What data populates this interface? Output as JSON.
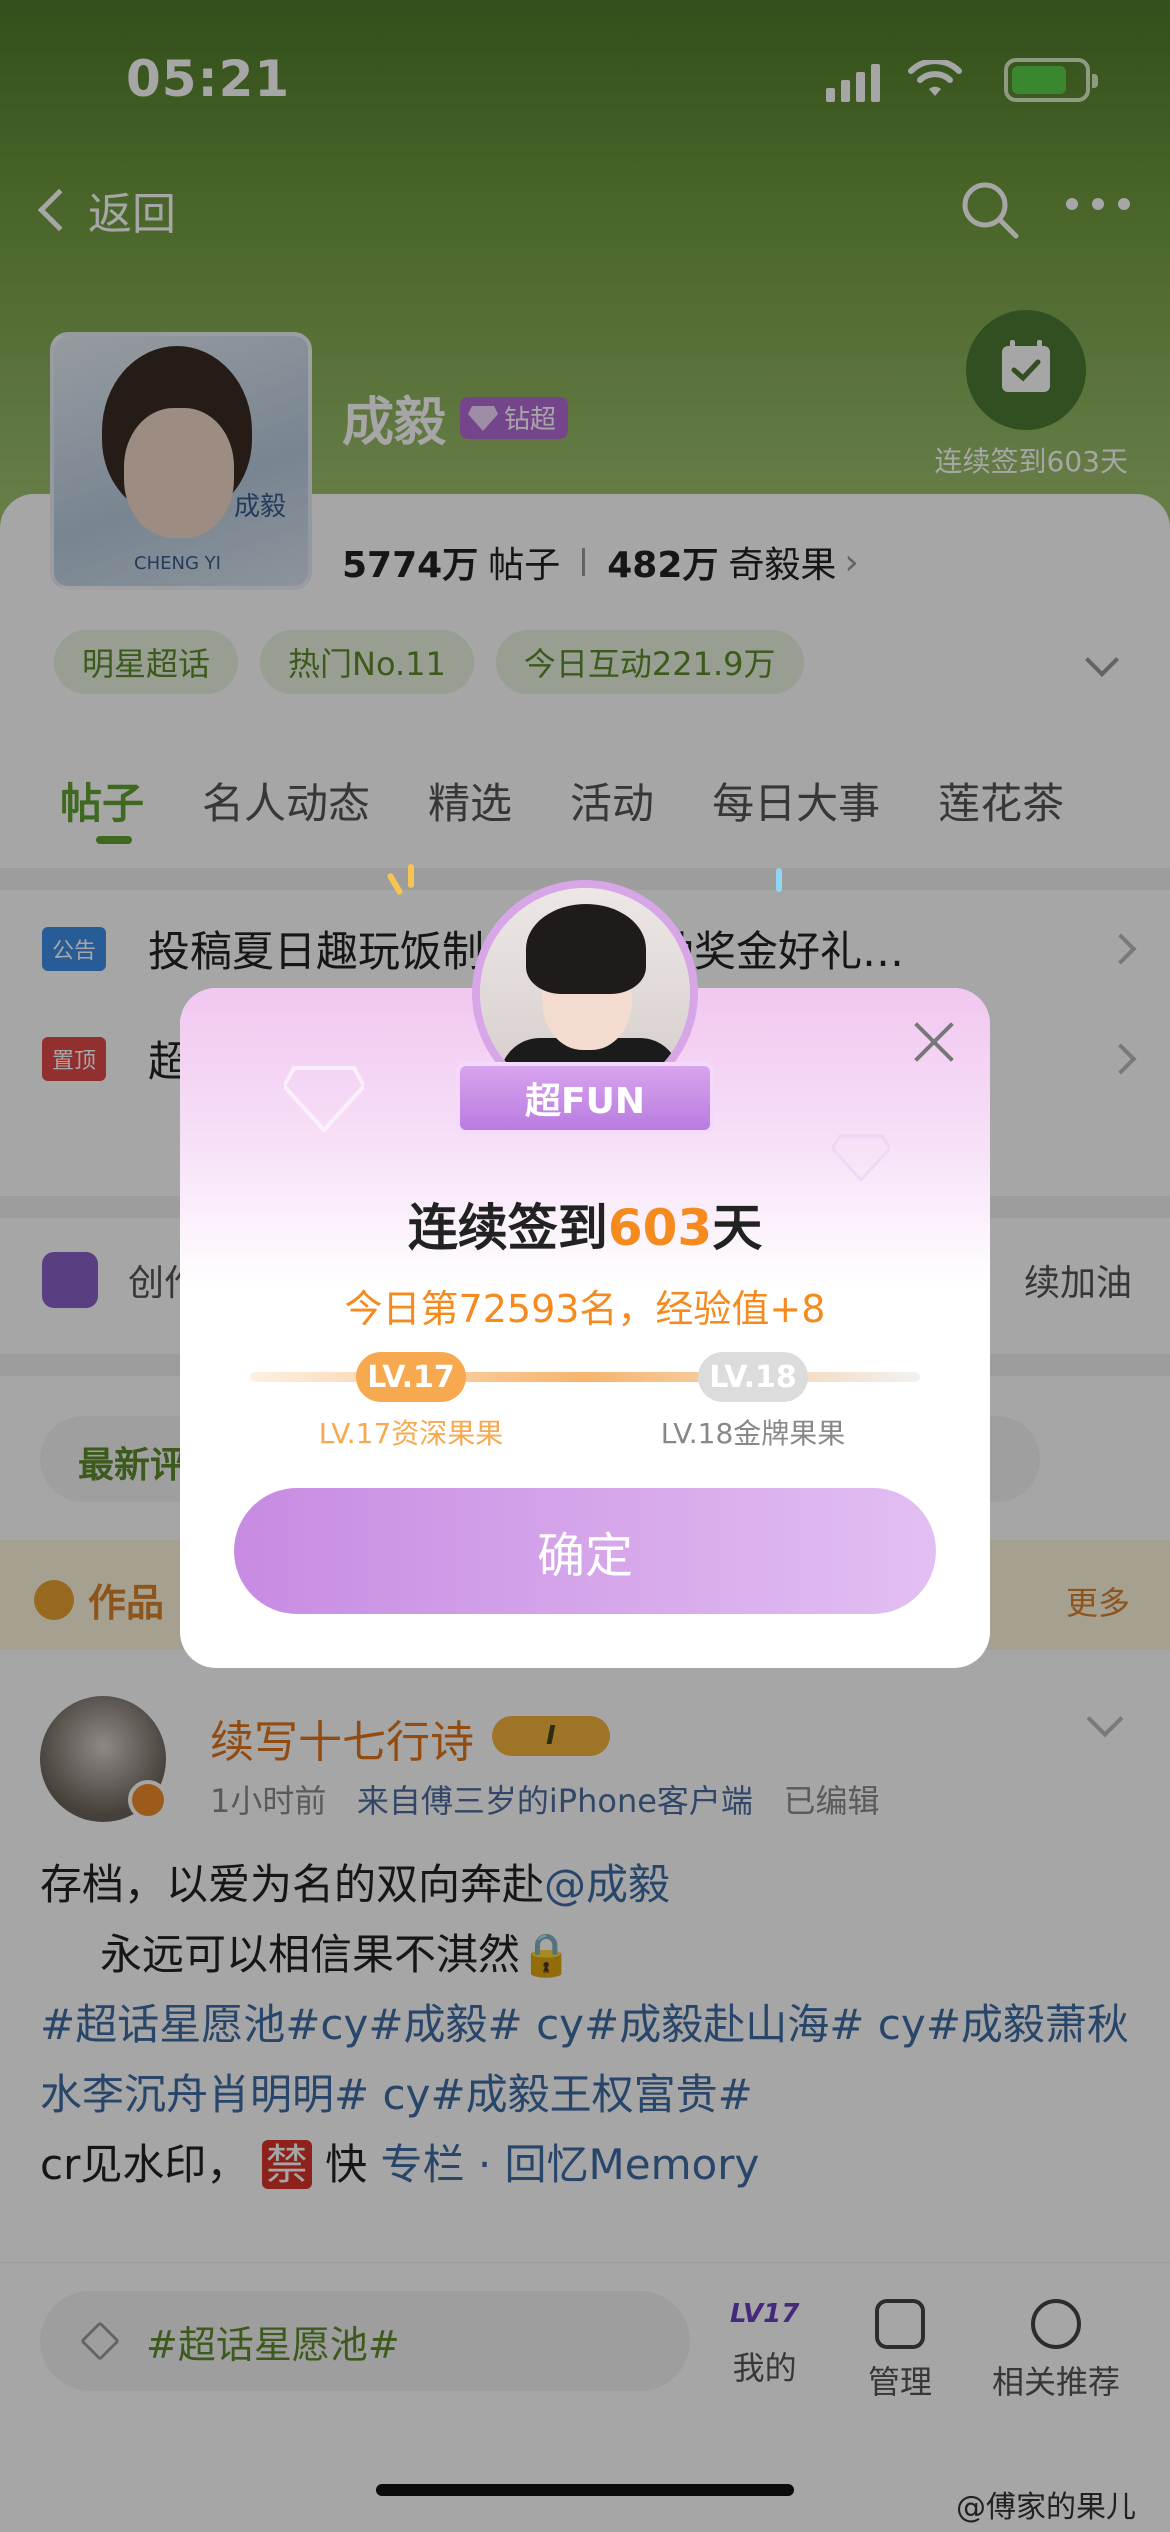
{
  "status": {
    "time": "05:21"
  },
  "nav": {
    "back_label": "返回"
  },
  "topic": {
    "name": "成毅",
    "badge": "钻超",
    "cover_text": "成毅",
    "cover_sub": "CHENG YI",
    "checkin_label": "连续签到603天",
    "posts_count": "5774万",
    "posts_label": "帖子",
    "fans_count": "482万",
    "fans_label": "奇毅果",
    "chips": [
      "明星超话",
      "热门No.11",
      "今日互动221.9万"
    ]
  },
  "tabs": [
    "帖子",
    "名人动态",
    "精选",
    "活动",
    "每日大事",
    "莲花茶"
  ],
  "notices": [
    {
      "tag": "公告",
      "tag_color": "#3c8ee6",
      "text": "投稿夏日趣玩饭制，创作激励奖金好礼…"
    },
    {
      "tag": "置顶",
      "tag_color": "#e04a4a",
      "text": "超"
    }
  ],
  "create_row": {
    "left": "创作",
    "right": "续加油"
  },
  "comment_bar": {
    "label": "最新评论"
  },
  "works": {
    "label": "作品",
    "more": "更多"
  },
  "post": {
    "author": "续写十七行诗",
    "crown_level": "I",
    "time": "1小时前",
    "source": "来自傅三岁的iPhone客户端",
    "edited": "已编辑",
    "line1_prefix": "存档，以爱为名的双向奔赴",
    "line1_mention": "@成毅",
    "line2": "永远可以相信果不淇然🔒",
    "line3": "#超话星愿池#cy#成毅# cy#成毅赴山海# cy#成毅萧秋水李沉舟肖明明# cy#成毅王权富贵#",
    "line4_prefix": "cr见水印，",
    "line4_ban": "禁",
    "line4_fast": "快",
    "line4_link": "专栏 · 回忆Memory"
  },
  "bottom": {
    "input_placeholder": "#超话星愿池#",
    "me_label": "我的",
    "me_level": "LV17",
    "manage_label": "管理",
    "recommend_label": "相关推荐"
  },
  "watermark": "@傅家的果儿",
  "modal": {
    "ribbon": "超FUN",
    "title_prefix": "连续签到",
    "title_days": "603",
    "title_suffix": "天",
    "rank": "今日第72593名，经验值+8",
    "level_current": "LV.17",
    "level_next": "LV.18",
    "level_current_name": "LV.17资深果果",
    "level_next_name": "LV.18金牌果果",
    "confirm": "确定"
  },
  "colors": {
    "accent_green": "#62a232",
    "accent_orange": "#f58a1f",
    "modal_purple": "#c78be2"
  }
}
